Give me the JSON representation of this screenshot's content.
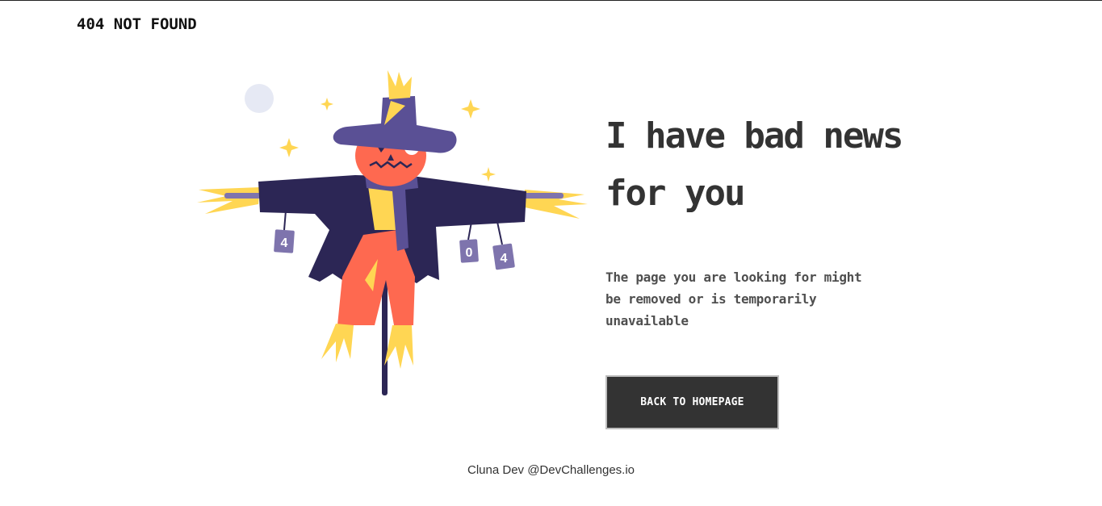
{
  "header": {
    "brand": "404 NOT FOUND"
  },
  "illustration": {
    "name": "scarecrow",
    "can_labels": [
      "4",
      "0",
      "4"
    ],
    "colors": {
      "hat": "#5a5095",
      "face": "#fe6950",
      "coat": "#2c2655",
      "straw": "#ffd653",
      "pants": "#fe6950",
      "cans": "#7e74ad",
      "moon": "#e6e9f4",
      "stars": "#ffd653"
    }
  },
  "main": {
    "headline": "I have bad news for you",
    "message": "The page you are looking for might be removed or is temporarily unavailable",
    "button_label": "BACK TO HOMEPAGE"
  },
  "footer": {
    "text": "Cluna Dev @DevChallenges.io"
  },
  "colors": {
    "text_dark": "#333333",
    "text_body": "#4f4f4f",
    "button_bg": "#333333",
    "button_text": "#ffffff"
  }
}
